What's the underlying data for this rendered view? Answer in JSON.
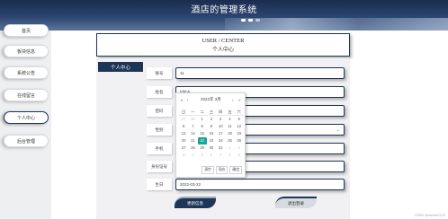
{
  "header": {
    "title": "酒店的管理系统"
  },
  "sidebar": {
    "items": [
      {
        "label": "首页"
      },
      {
        "label": "板块信息"
      },
      {
        "label": "系统公告"
      },
      {
        "label": "在线留言"
      },
      {
        "label": "个人中心",
        "active": true
      },
      {
        "label": "后台管理"
      }
    ]
  },
  "center": {
    "title_en": "USER / CENTER",
    "title_cn": "个人中心"
  },
  "form": {
    "tab": "个人中心",
    "fields": [
      {
        "label": "账号",
        "value": "11"
      },
      {
        "label": "姓名",
        "value": "hfhhh"
      },
      {
        "label": "密码",
        "value": ""
      },
      {
        "label": "性别",
        "value": ""
      },
      {
        "label": "手机",
        "value": ""
      },
      {
        "label": "身份证号",
        "value": ""
      },
      {
        "label": "生日",
        "value": "2022-03-22"
      }
    ],
    "update_button": "更新信息",
    "logout_button": "退出登录"
  },
  "date_picker": {
    "year_month": "2022年 3月",
    "prev_year": "«",
    "prev_month": "‹",
    "next_month": "›",
    "next_year": "»",
    "weekdays": [
      "日",
      "一",
      "二",
      "三",
      "四",
      "五",
      "六"
    ],
    "weeks": [
      [
        "27",
        "28",
        "1",
        "2",
        "3",
        "4",
        "5"
      ],
      [
        "6",
        "7",
        "8",
        "9",
        "10",
        "11",
        "12"
      ],
      [
        "13",
        "14",
        "15",
        "16",
        "17",
        "18",
        "19"
      ],
      [
        "20",
        "21",
        "22",
        "23",
        "24",
        "25",
        "26"
      ],
      [
        "27",
        "28",
        "29",
        "30",
        "31",
        "1",
        "2"
      ],
      [
        "3",
        "4",
        "5",
        "6",
        "7",
        "8",
        "9"
      ]
    ],
    "selected_day": "22",
    "footer_buttons": [
      "清空",
      "现在",
      "确定"
    ]
  },
  "watermark": "CSDN @weixin0123"
}
